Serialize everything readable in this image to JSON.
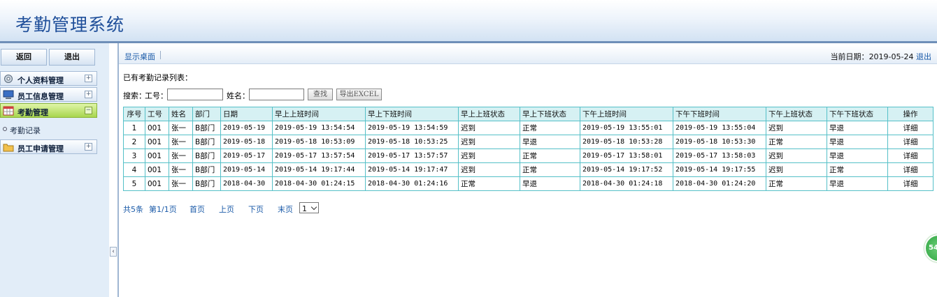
{
  "app": {
    "title": "考勤管理系统"
  },
  "sidebar": {
    "back_label": "返回",
    "exit_label": "退出",
    "menus": [
      {
        "label": "个人资料管理",
        "icon": "gear-icon",
        "toggle": "⊞"
      },
      {
        "label": "员工信息管理",
        "icon": "monitor-icon",
        "toggle": "⊞"
      },
      {
        "label": "考勤管理",
        "icon": "calendar-icon",
        "toggle": "⊟",
        "active": true
      },
      {
        "label": "员工申请管理",
        "icon": "folder-icon",
        "toggle": "⊞"
      }
    ],
    "submenu": [
      {
        "label": "考勤记录"
      }
    ],
    "collapse_glyph": "‹"
  },
  "topbar": {
    "tab_label": "显示桌面",
    "date_label": "当前日期：",
    "date_value": "2019-05-24",
    "logout_label": "退出"
  },
  "main": {
    "list_title": "已有考勤记录列表：",
    "search": {
      "search_label": "搜索：",
      "id_label": "工号：",
      "id_value": "",
      "name_label": "姓名：",
      "name_value": "",
      "find_label": "查找",
      "export_label": "导出EXCEL"
    },
    "table": {
      "headers": [
        "序号",
        "工号",
        "姓名",
        "部门",
        "日期",
        "早上上班时间",
        "早上下班时间",
        "早上上班状态",
        "早上下班状态",
        "下午上班时间",
        "下午下班时间",
        "下午上班状态",
        "下午下班状态",
        "操作"
      ],
      "rows": [
        [
          "1",
          "001",
          "张一",
          "B部门",
          "2019-05-19",
          "2019-05-19 13:54:54",
          "2019-05-19 13:54:59",
          "迟到",
          "正常",
          "2019-05-19 13:55:01",
          "2019-05-19 13:55:04",
          "迟到",
          "早退",
          "详细"
        ],
        [
          "2",
          "001",
          "张一",
          "B部门",
          "2019-05-18",
          "2019-05-18 10:53:09",
          "2019-05-18 10:53:25",
          "迟到",
          "早退",
          "2019-05-18 10:53:28",
          "2019-05-18 10:53:30",
          "正常",
          "早退",
          "详细"
        ],
        [
          "3",
          "001",
          "张一",
          "B部门",
          "2019-05-17",
          "2019-05-17 13:57:54",
          "2019-05-17 13:57:57",
          "迟到",
          "正常",
          "2019-05-17 13:58:01",
          "2019-05-17 13:58:03",
          "迟到",
          "早退",
          "详细"
        ],
        [
          "4",
          "001",
          "张一",
          "B部门",
          "2019-05-14",
          "2019-05-14 19:17:44",
          "2019-05-14 19:17:47",
          "迟到",
          "正常",
          "2019-05-14 19:17:52",
          "2019-05-14 19:17:55",
          "迟到",
          "正常",
          "详细"
        ],
        [
          "5",
          "001",
          "张一",
          "B部门",
          "2018-04-30",
          "2018-04-30 01:24:15",
          "2018-04-30 01:24:16",
          "正常",
          "早退",
          "2018-04-30 01:24:18",
          "2018-04-30 01:24:20",
          "正常",
          "早退",
          "详细"
        ]
      ]
    },
    "pager": {
      "total": "共5条",
      "page_info": "第1/1页",
      "first": "首页",
      "prev": "上页",
      "next": "下页",
      "last": "末页",
      "page_select": "1"
    }
  },
  "badge": {
    "text": "54"
  },
  "colors": {
    "header_border": "#6e8fb8",
    "table_border": "#55c0c8",
    "table_header": "#d6f1f3",
    "active_menu": "#a8d64e",
    "link": "#1a5aa8"
  }
}
